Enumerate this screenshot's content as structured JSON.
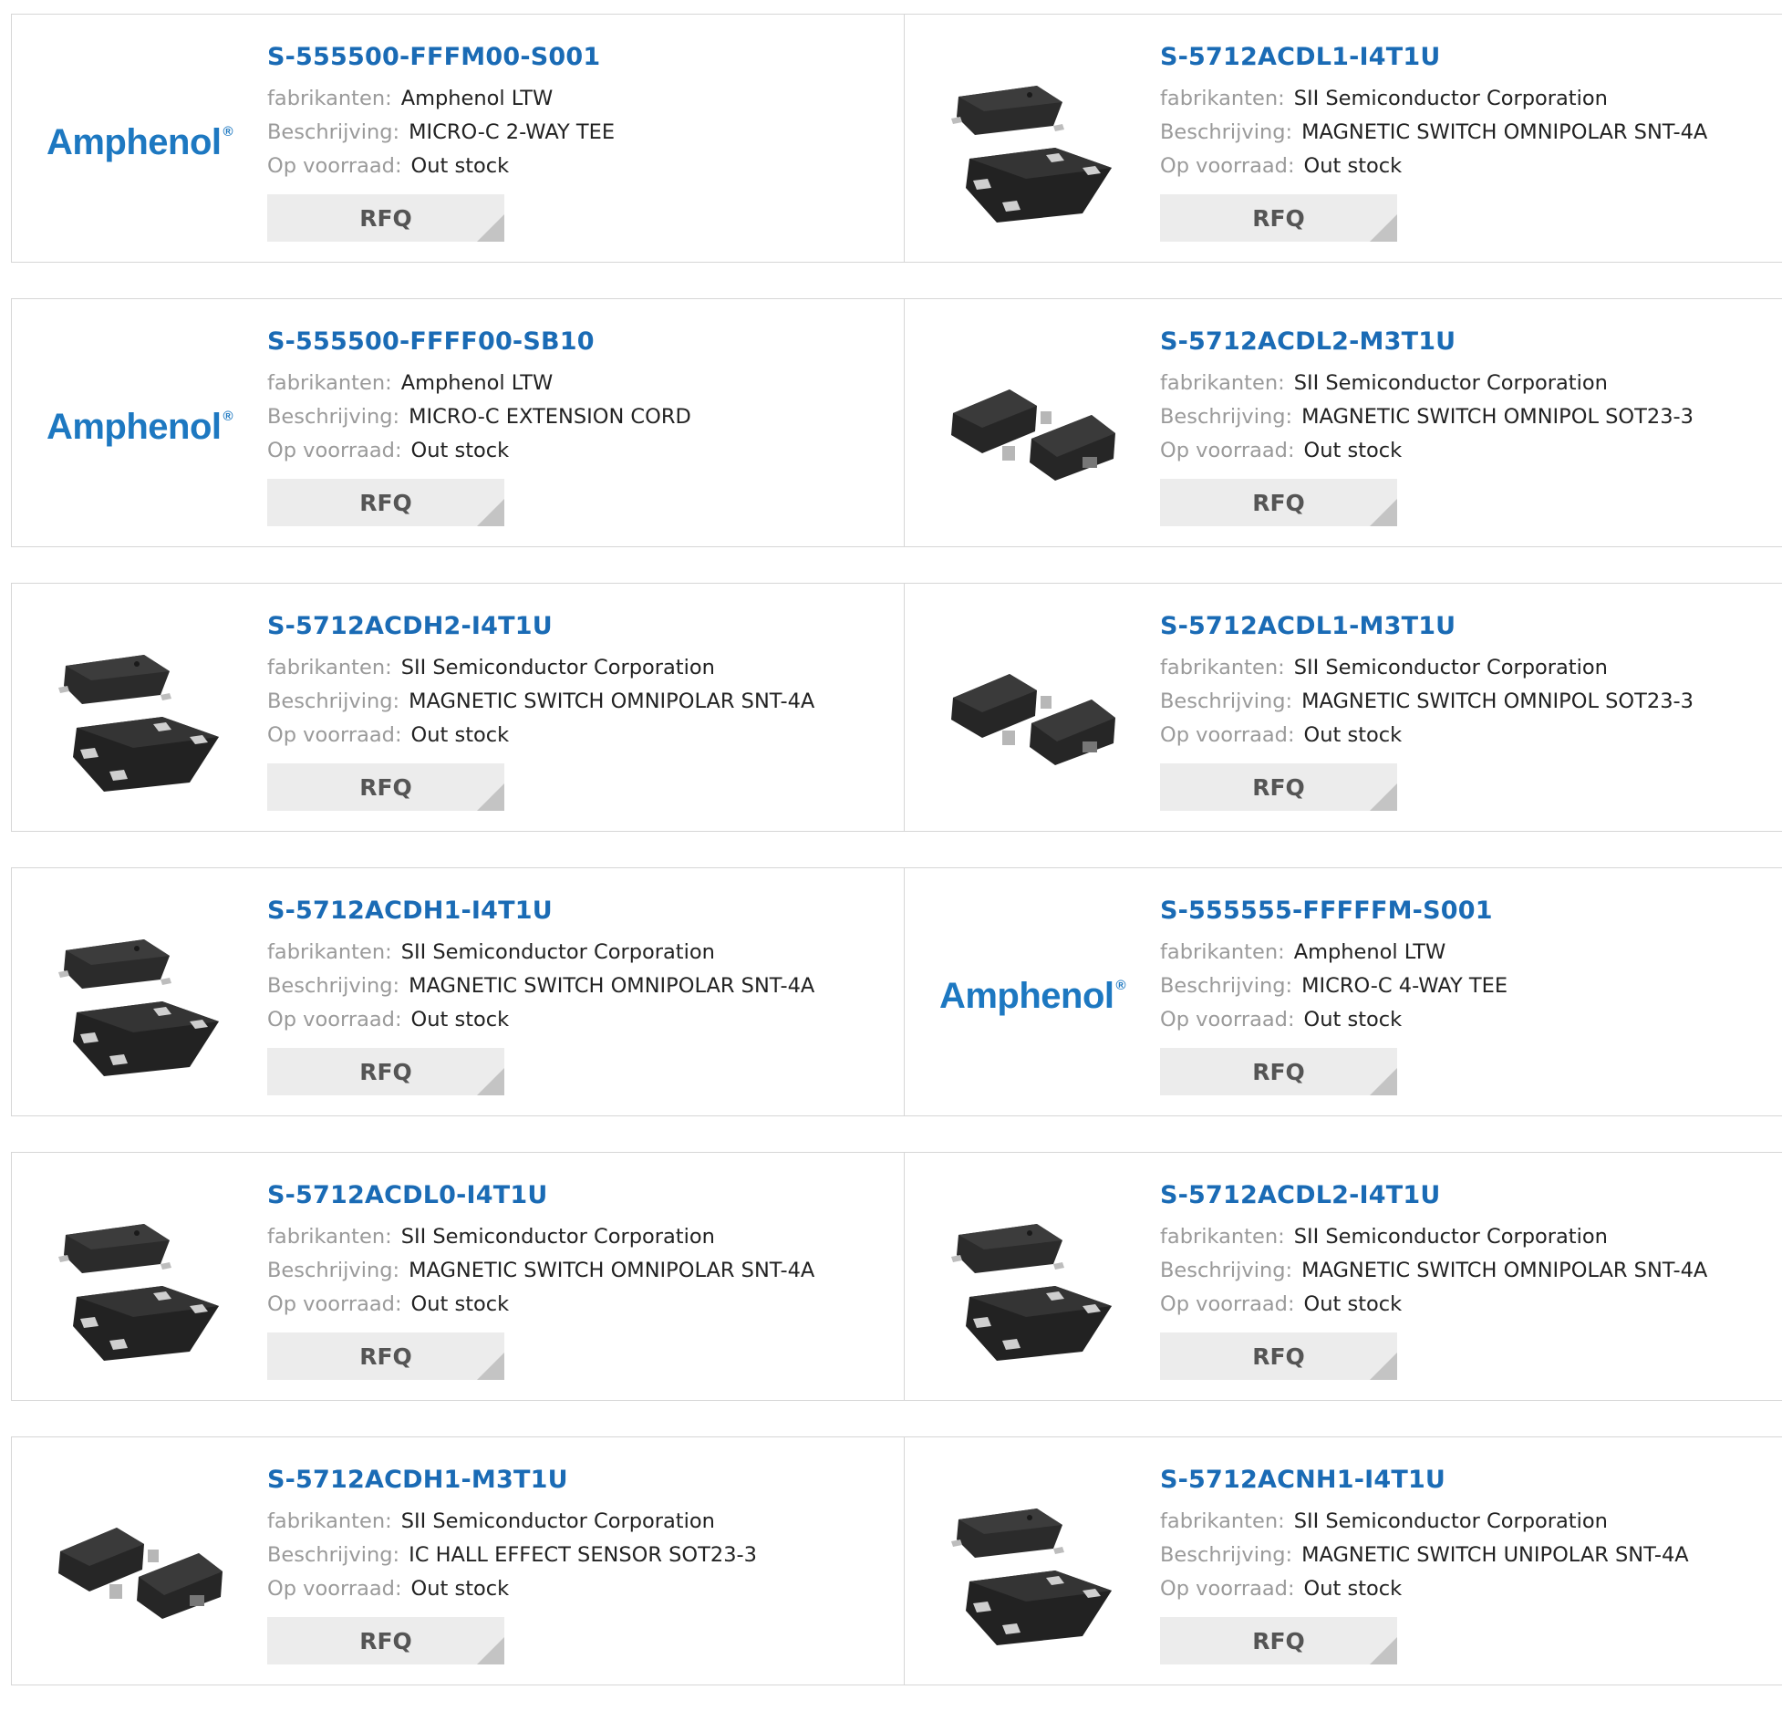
{
  "labels": {
    "manufacturer": "fabrikanten:",
    "description": "Beschrijving:",
    "stock": "Op voorraad:",
    "rfq": "RFQ"
  },
  "colors": {
    "link": "#1a6bb5",
    "label": "#9a9a9a",
    "button_bg": "#ececec"
  },
  "logo_text": "Amphenol",
  "products": [
    {
      "pn": "S-555500-FFFM00-S001",
      "manufacturer": "Amphenol LTW",
      "description": "MICRO-C 2-WAY TEE",
      "stock": "Out stock",
      "image": "amphenol-logo"
    },
    {
      "pn": "S-5712ACDL1-I4T1U",
      "manufacturer": "SII Semiconductor Corporation",
      "description": "MAGNETIC SWITCH OMNIPOLAR SNT-4A",
      "stock": "Out stock",
      "image": "snt-4a-package"
    },
    {
      "pn": "S-555500-FFFF00-SB10",
      "manufacturer": "Amphenol LTW",
      "description": "MICRO-C EXTENSION CORD",
      "stock": "Out stock",
      "image": "amphenol-logo"
    },
    {
      "pn": "S-5712ACDL2-M3T1U",
      "manufacturer": "SII Semiconductor Corporation",
      "description": "MAGNETIC SWITCH OMNIPOL SOT23-3",
      "stock": "Out stock",
      "image": "sot23-3-package"
    },
    {
      "pn": "S-5712ACDH2-I4T1U",
      "manufacturer": "SII Semiconductor Corporation",
      "description": "MAGNETIC SWITCH OMNIPOLAR SNT-4A",
      "stock": "Out stock",
      "image": "snt-4a-package"
    },
    {
      "pn": "S-5712ACDL1-M3T1U",
      "manufacturer": "SII Semiconductor Corporation",
      "description": "MAGNETIC SWITCH OMNIPOL SOT23-3",
      "stock": "Out stock",
      "image": "sot23-3-package"
    },
    {
      "pn": "S-5712ACDH1-I4T1U",
      "manufacturer": "SII Semiconductor Corporation",
      "description": "MAGNETIC SWITCH OMNIPOLAR SNT-4A",
      "stock": "Out stock",
      "image": "snt-4a-package"
    },
    {
      "pn": "S-555555-FFFFFM-S001",
      "manufacturer": "Amphenol LTW",
      "description": "MICRO-C 4-WAY TEE",
      "stock": "Out stock",
      "image": "amphenol-logo"
    },
    {
      "pn": "S-5712ACDL0-I4T1U",
      "manufacturer": "SII Semiconductor Corporation",
      "description": "MAGNETIC SWITCH OMNIPOLAR SNT-4A",
      "stock": "Out stock",
      "image": "snt-4a-package"
    },
    {
      "pn": "S-5712ACDL2-I4T1U",
      "manufacturer": "SII Semiconductor Corporation",
      "description": "MAGNETIC SWITCH OMNIPOLAR SNT-4A",
      "stock": "Out stock",
      "image": "snt-4a-package"
    },
    {
      "pn": "S-5712ACDH1-M3T1U",
      "manufacturer": "SII Semiconductor Corporation",
      "description": "IC HALL EFFECT SENSOR SOT23-3",
      "stock": "Out stock",
      "image": "sot23-3-package"
    },
    {
      "pn": "S-5712ACNH1-I4T1U",
      "manufacturer": "SII Semiconductor Corporation",
      "description": "MAGNETIC SWITCH UNIPOLAR SNT-4A",
      "stock": "Out stock",
      "image": "snt-4a-package"
    }
  ]
}
